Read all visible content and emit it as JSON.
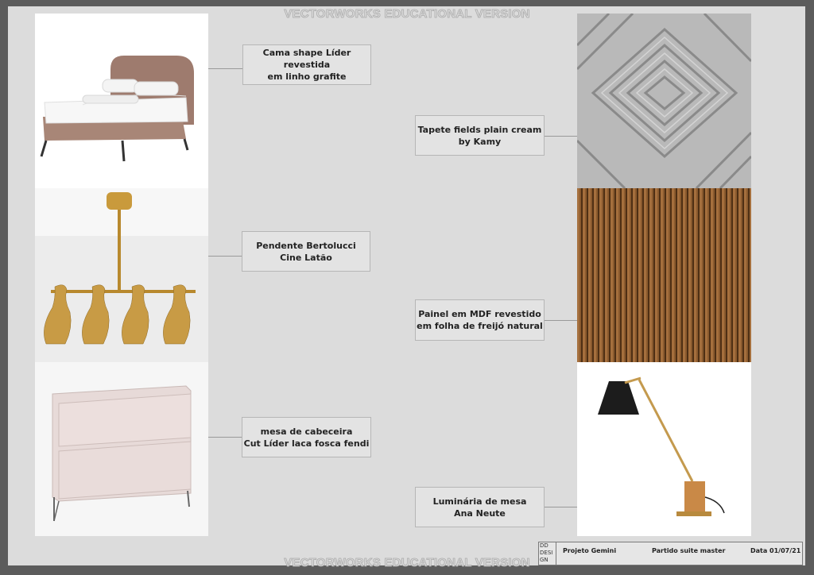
{
  "watermark": "VECTORWORKS EDUCATIONAL VERSION",
  "items": [
    {
      "label": "Cama shape Líder revestida\nem linho grafite",
      "image": "bed-photo"
    },
    {
      "label": "Pendente Bertolucci\nCine Latão",
      "image": "pendant-lamp-photo"
    },
    {
      "label": "mesa de cabeceira\nCut Líder laca fosca fendi",
      "image": "nightstand-photo"
    },
    {
      "label": "Tapete fields plain cream\nby Kamy",
      "image": "rug-photo"
    },
    {
      "label": "Painel em MDF revestido\nem folha de freijó natural",
      "image": "wood-panel-photo"
    },
    {
      "label": "Luminária de mesa\nAna Neute",
      "image": "desk-lamp-photo"
    }
  ],
  "titleblock": {
    "logo": "DD\nDESI\nGN",
    "project": "Projeto Gemini",
    "sheet": "Partido suite master",
    "date": "Data 01/07/21"
  }
}
